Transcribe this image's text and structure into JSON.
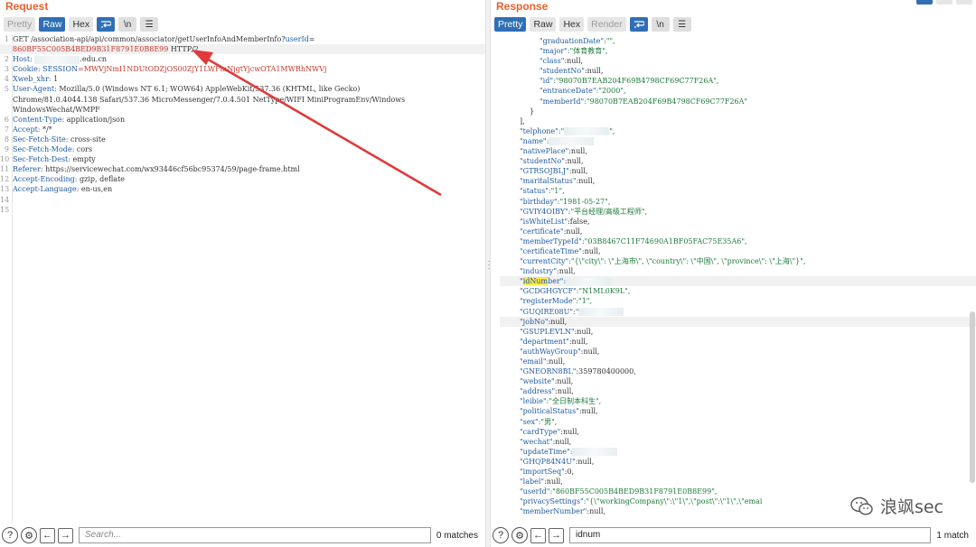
{
  "request": {
    "title": "Request",
    "tabs": [
      "Pretty",
      "Raw",
      "Hex"
    ],
    "active_tab": "Raw",
    "icons": [
      "wrap-icon",
      "newline-icon",
      "menu-icon"
    ],
    "lines": [
      {
        "n": "1",
        "parts": [
          {
            "t": "GET /association-api/api/common/associator/getUserInfoAndMemberInfo?",
            "c": "v"
          },
          {
            "t": "userId",
            "c": "k"
          },
          {
            "t": "=",
            "c": "v"
          }
        ]
      },
      {
        "n": "",
        "hl": true,
        "parts": [
          {
            "t": "860BF55C005B4BED9B31F8791E0B8E99",
            "c": "red"
          },
          {
            "t": " HTTP/2",
            "c": "v"
          }
        ]
      },
      {
        "n": "2",
        "parts": [
          {
            "t": "Host: ",
            "c": "k"
          },
          {
            "t": "BLUR"
          },
          {
            "t": ".edu.cn",
            "c": "v"
          }
        ]
      },
      {
        "n": "3",
        "parts": [
          {
            "t": "Cookie: ",
            "c": "k"
          },
          {
            "t": "SESSION",
            "c": "k"
          },
          {
            "t": "=MWVjNmI1NDUtODZjOS00ZjY1LWFmNjgtYjcwOTA1MWRhNWVj",
            "c": "red"
          }
        ]
      },
      {
        "n": "4",
        "parts": [
          {
            "t": "Xweb_xhr: ",
            "c": "k"
          },
          {
            "t": "1",
            "c": "v"
          }
        ]
      },
      {
        "n": "5",
        "parts": [
          {
            "t": "User-Agent: ",
            "c": "k"
          },
          {
            "t": "Mozilla/5.0 (Windows NT 6.1; WOW64) AppleWebKit/537.36 (KHTML, like Gecko)",
            "c": "v"
          }
        ]
      },
      {
        "n": "",
        "parts": [
          {
            "t": "Chrome/81.0.4044.138 Safari/537.36 MicroMessenger/7.0.4.501 NetType/WIFI MiniProgramEnv/Windows",
            "c": "v"
          }
        ]
      },
      {
        "n": "",
        "parts": [
          {
            "t": "WindowsWechat/WMPF",
            "c": "v"
          }
        ]
      },
      {
        "n": "6",
        "parts": [
          {
            "t": "Content-Type: ",
            "c": "k"
          },
          {
            "t": "application/json",
            "c": "v"
          }
        ]
      },
      {
        "n": "7",
        "parts": [
          {
            "t": "Accept: ",
            "c": "k"
          },
          {
            "t": "*/*",
            "c": "v"
          }
        ]
      },
      {
        "n": "8",
        "parts": [
          {
            "t": "Sec-Fetch-Site: ",
            "c": "k"
          },
          {
            "t": "cross-site",
            "c": "v"
          }
        ]
      },
      {
        "n": "9",
        "parts": [
          {
            "t": "Sec-Fetch-Mode: ",
            "c": "k"
          },
          {
            "t": "cors",
            "c": "v"
          }
        ]
      },
      {
        "n": "10",
        "parts": [
          {
            "t": "Sec-Fetch-Dest: ",
            "c": "k"
          },
          {
            "t": "empty",
            "c": "v"
          }
        ]
      },
      {
        "n": "11",
        "parts": [
          {
            "t": "Referer: ",
            "c": "k"
          },
          {
            "t": "https://servicewechat.com/wx93446cf56bc95374/59/page-frame.html",
            "c": "v"
          }
        ]
      },
      {
        "n": "12",
        "parts": [
          {
            "t": "Accept-Encoding: ",
            "c": "k"
          },
          {
            "t": "gzip, deflate",
            "c": "v"
          }
        ]
      },
      {
        "n": "13",
        "parts": [
          {
            "t": "Accept-Language: ",
            "c": "k"
          },
          {
            "t": "en-us,en",
            "c": "v"
          }
        ]
      },
      {
        "n": "14",
        "parts": []
      },
      {
        "n": "15",
        "parts": []
      }
    ],
    "search_placeholder": "Search...",
    "match_count": "0 matches"
  },
  "response": {
    "title": "Response",
    "tabs": [
      "Pretty",
      "Raw",
      "Hex",
      "Render"
    ],
    "active_tab": "Pretty",
    "lines": [
      {
        "i": 8,
        "parts": [
          {
            "t": "\"graduationDate\"",
            "c": "jk"
          },
          {
            "t": ":\"\",",
            "c": "js"
          }
        ]
      },
      {
        "i": 8,
        "parts": [
          {
            "t": "\"major\"",
            "c": "jk"
          },
          {
            "t": ":\"体育教育\",",
            "c": "js"
          }
        ]
      },
      {
        "i": 8,
        "parts": [
          {
            "t": "\"class\"",
            "c": "jk"
          },
          {
            "t": ":null,",
            "c": "jn"
          }
        ]
      },
      {
        "i": 8,
        "parts": [
          {
            "t": "\"studentNo\"",
            "c": "jk"
          },
          {
            "t": ":null,",
            "c": "jn"
          }
        ]
      },
      {
        "i": 8,
        "parts": [
          {
            "t": "\"id\"",
            "c": "jk"
          },
          {
            "t": ":\"98070B7EAB204F69B4798CF69C77F26A\",",
            "c": "js"
          }
        ]
      },
      {
        "i": 8,
        "parts": [
          {
            "t": "\"entranceDate\"",
            "c": "jk"
          },
          {
            "t": ":\"2000\",",
            "c": "js"
          }
        ]
      },
      {
        "i": 8,
        "parts": [
          {
            "t": "\"memberId\"",
            "c": "jk"
          },
          {
            "t": ":\"98070B7EAB204F69B4798CF69C77F26A\"",
            "c": "js"
          }
        ]
      },
      {
        "i": 6,
        "parts": [
          {
            "t": "}",
            "c": "jn"
          }
        ]
      },
      {
        "i": 4,
        "parts": [
          {
            "t": "],",
            "c": "jn"
          }
        ]
      },
      {
        "i": 4,
        "parts": [
          {
            "t": "\"telphone\"",
            "c": "jk"
          },
          {
            "t": ":\"",
            "c": "js"
          },
          {
            "t": "BLUR"
          },
          {
            "t": "\",",
            "c": "js"
          }
        ]
      },
      {
        "i": 4,
        "parts": [
          {
            "t": "\"name\"",
            "c": "jk"
          },
          {
            "t": ":",
            "c": "js"
          },
          {
            "t": "BLUR"
          }
        ]
      },
      {
        "i": 4,
        "parts": [
          {
            "t": "\"nativePlace\"",
            "c": "jk"
          },
          {
            "t": ":null,",
            "c": "jn"
          }
        ]
      },
      {
        "i": 4,
        "parts": [
          {
            "t": "\"studentNo\"",
            "c": "jk"
          },
          {
            "t": ":null,",
            "c": "jn"
          }
        ]
      },
      {
        "i": 4,
        "parts": [
          {
            "t": "\"GTRSOJBLJ\"",
            "c": "jk"
          },
          {
            "t": ":null,",
            "c": "jn"
          }
        ]
      },
      {
        "i": 4,
        "parts": [
          {
            "t": "\"maritalStatus\"",
            "c": "jk"
          },
          {
            "t": ":null,",
            "c": "jn"
          }
        ]
      },
      {
        "i": 4,
        "parts": [
          {
            "t": "\"status\"",
            "c": "jk"
          },
          {
            "t": ":\"1\",",
            "c": "js"
          }
        ]
      },
      {
        "i": 4,
        "parts": [
          {
            "t": "\"birthday\"",
            "c": "jk"
          },
          {
            "t": ":\"1981-05-27\",",
            "c": "js"
          }
        ]
      },
      {
        "i": 4,
        "parts": [
          {
            "t": "\"GVIY4OIBY\"",
            "c": "jk"
          },
          {
            "t": ":\"平台经理/高级工程师\",",
            "c": "js"
          }
        ]
      },
      {
        "i": 4,
        "parts": [
          {
            "t": "\"isWhiteList\"",
            "c": "jk"
          },
          {
            "t": ":false,",
            "c": "jn"
          }
        ]
      },
      {
        "i": 4,
        "parts": [
          {
            "t": "\"certificate\"",
            "c": "jk"
          },
          {
            "t": ":null,",
            "c": "jn"
          }
        ]
      },
      {
        "i": 4,
        "parts": [
          {
            "t": "\"memberTypeId\"",
            "c": "jk"
          },
          {
            "t": ":\"03B8467C11F74690A1BF05FAC75E35A6\",",
            "c": "js"
          }
        ]
      },
      {
        "i": 4,
        "parts": [
          {
            "t": "\"certificateTime\"",
            "c": "jk"
          },
          {
            "t": ":null,",
            "c": "jn"
          }
        ]
      },
      {
        "i": 4,
        "parts": [
          {
            "t": "\"currentCity\"",
            "c": "jk"
          },
          {
            "t": ":\"{\\\"city\\\": \\\"上海市\\\", \\\"country\\\": \\\"中国\\\", \\\"province\\\": \\\"上海\\\"}\",",
            "c": "js"
          }
        ]
      },
      {
        "i": 4,
        "parts": [
          {
            "t": "\"industry\"",
            "c": "jk"
          },
          {
            "t": ":null,",
            "c": "jn"
          }
        ]
      },
      {
        "i": 4,
        "hl": true,
        "parts": [
          {
            "t": "\"",
            "c": "jk"
          },
          {
            "t": "idNum",
            "c": "jk",
            "y": true
          },
          {
            "t": "ber\"",
            "c": "jk"
          },
          {
            "t": ":",
            "c": "js"
          },
          {
            "t": "BLUR"
          }
        ]
      },
      {
        "i": 4,
        "parts": [
          {
            "t": "\"GCDGHGYCF\"",
            "c": "jk"
          },
          {
            "t": ":\"N1ML0K9L\",",
            "c": "js"
          }
        ]
      },
      {
        "i": 4,
        "parts": [
          {
            "t": "\"registerMode\"",
            "c": "jk"
          },
          {
            "t": ":\"1\",",
            "c": "js"
          }
        ]
      },
      {
        "i": 4,
        "parts": [
          {
            "t": "\"GUQIRE08U\"",
            "c": "jk"
          },
          {
            "t": ":\"",
            "c": "js"
          },
          {
            "t": "BLUR"
          }
        ]
      },
      {
        "i": 4,
        "hl": true,
        "parts": [
          {
            "t": "\"jobNo\"",
            "c": "jk"
          },
          {
            "t": ":null,",
            "c": "jn"
          }
        ]
      },
      {
        "i": 4,
        "parts": [
          {
            "t": "\"GSUPLEVLN\"",
            "c": "jk"
          },
          {
            "t": ":null,",
            "c": "jn"
          }
        ]
      },
      {
        "i": 4,
        "parts": [
          {
            "t": "\"department\"",
            "c": "jk"
          },
          {
            "t": ":null,",
            "c": "jn"
          }
        ]
      },
      {
        "i": 4,
        "parts": [
          {
            "t": "\"authWayGroup\"",
            "c": "jk"
          },
          {
            "t": ":null,",
            "c": "jn"
          }
        ]
      },
      {
        "i": 4,
        "parts": [
          {
            "t": "\"email\"",
            "c": "jk"
          },
          {
            "t": ":null,",
            "c": "jn"
          }
        ]
      },
      {
        "i": 4,
        "parts": [
          {
            "t": "\"GNEORN8BL\"",
            "c": "jk"
          },
          {
            "t": ":359780400000,",
            "c": "jn"
          }
        ]
      },
      {
        "i": 4,
        "parts": [
          {
            "t": "\"website\"",
            "c": "jk"
          },
          {
            "t": ":null,",
            "c": "jn"
          }
        ]
      },
      {
        "i": 4,
        "parts": [
          {
            "t": "\"address\"",
            "c": "jk"
          },
          {
            "t": ":null,",
            "c": "jn"
          }
        ]
      },
      {
        "i": 4,
        "parts": [
          {
            "t": "\"leibie\"",
            "c": "jk"
          },
          {
            "t": ":\"全日制本科生\",",
            "c": "js"
          }
        ]
      },
      {
        "i": 4,
        "parts": [
          {
            "t": "\"politicalStatus\"",
            "c": "jk"
          },
          {
            "t": ":null,",
            "c": "jn"
          }
        ]
      },
      {
        "i": 4,
        "parts": [
          {
            "t": "\"sex\"",
            "c": "jk"
          },
          {
            "t": ":\"男\",",
            "c": "js"
          }
        ]
      },
      {
        "i": 4,
        "parts": [
          {
            "t": "\"cardType\"",
            "c": "jk"
          },
          {
            "t": ":null,",
            "c": "jn"
          }
        ]
      },
      {
        "i": 4,
        "parts": [
          {
            "t": "\"wechat\"",
            "c": "jk"
          },
          {
            "t": ":null,",
            "c": "jn"
          }
        ]
      },
      {
        "i": 4,
        "parts": [
          {
            "t": "\"updateTime\"",
            "c": "jk"
          },
          {
            "t": ":",
            "c": "js"
          },
          {
            "t": "BLUR"
          }
        ]
      },
      {
        "i": 4,
        "parts": [
          {
            "t": "\"GHQP84N4U\"",
            "c": "jk"
          },
          {
            "t": ":null,",
            "c": "jn"
          }
        ]
      },
      {
        "i": 4,
        "parts": [
          {
            "t": "\"importSeq\"",
            "c": "jk"
          },
          {
            "t": ":0,",
            "c": "jn"
          }
        ]
      },
      {
        "i": 4,
        "parts": [
          {
            "t": "\"label\"",
            "c": "jk"
          },
          {
            "t": ":null,",
            "c": "jn"
          }
        ]
      },
      {
        "i": 4,
        "parts": [
          {
            "t": "\"userId\"",
            "c": "jk"
          },
          {
            "t": ":\"860BF55C005B4BED9B31F8791E0B8E99\",",
            "c": "js"
          }
        ]
      },
      {
        "i": 4,
        "parts": [
          {
            "t": "\"privacySettings\"",
            "c": "jk"
          },
          {
            "t": ":\"{\\\"workingCompany\\\":\\\"1\\\",\\\"post\\\":\\\"1\\\",\\\"emai",
            "c": "js"
          }
        ]
      },
      {
        "i": 4,
        "parts": [
          {
            "t": "\"memberNumber\"",
            "c": "jk"
          },
          {
            "t": ":null,",
            "c": "jn"
          }
        ]
      }
    ],
    "search_value": "idnum",
    "match_count": "1 match"
  },
  "watermark": {
    "text": "浪飒sec"
  },
  "colors": {
    "accent": "#e8612c",
    "active_blue": "#2f6fb5",
    "arrow_red": "#e03a3a"
  }
}
